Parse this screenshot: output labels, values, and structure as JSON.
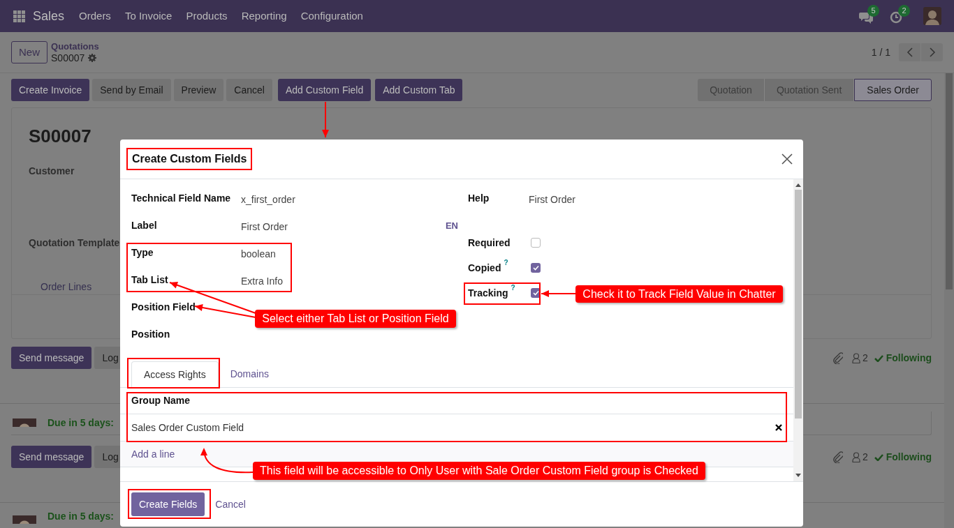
{
  "navbar": {
    "app": "Sales",
    "menu": [
      "Orders",
      "To Invoice",
      "Products",
      "Reporting",
      "Configuration"
    ],
    "messages_badge": "5",
    "activities_badge": "2"
  },
  "control_panel": {
    "new_button": "New",
    "breadcrumb": "Quotations",
    "record": "S00007",
    "pager": "1 / 1"
  },
  "action_buttons": [
    {
      "label": "Create Invoice",
      "kind": "primary"
    },
    {
      "label": "Send by Email",
      "kind": "secondary"
    },
    {
      "label": "Preview",
      "kind": "secondary"
    },
    {
      "label": "Cancel",
      "kind": "secondary"
    },
    {
      "label": "Add Custom Field",
      "kind": "primary"
    },
    {
      "label": "Add Custom Tab",
      "kind": "primary"
    }
  ],
  "status_stages": [
    {
      "label": "Quotation",
      "selected": false
    },
    {
      "label": "Quotation Sent",
      "selected": false
    },
    {
      "label": "Sales Order",
      "selected": true
    }
  ],
  "sheet": {
    "title": "S00007",
    "fields": [
      "Customer",
      "Quotation Template"
    ],
    "tab": "Order Lines"
  },
  "chatter": [
    {
      "buttons": [
        "Send message",
        "Log"
      ],
      "followers": "2",
      "follow": "Following",
      "activity": "Due in 5 days:"
    },
    {
      "buttons": [
        "Send message",
        "Log"
      ],
      "followers": "2",
      "follow": "Following",
      "activity": "Due in 5 days:"
    }
  ],
  "dialog": {
    "title": "Create Custom Fields",
    "fields": [
      {
        "label": "Technical Field Name",
        "value": "x_first_order"
      },
      {
        "label": "Label",
        "value": "First Order",
        "translate": "EN"
      },
      {
        "label": "Type",
        "value": "boolean"
      },
      {
        "label": "Tab List",
        "value": "Extra Info"
      },
      {
        "label": "Position Field"
      },
      {
        "label": "Position"
      }
    ],
    "help": {
      "label": "Help",
      "value": "First Order"
    },
    "options": [
      {
        "label": "Required",
        "checked": false
      },
      {
        "label": "Copied",
        "hint": "?",
        "checked": true
      },
      {
        "label": "Tracking",
        "hint": "?",
        "checked": true
      }
    ],
    "tabs": [
      {
        "label": "Access Rights",
        "selected": true
      },
      {
        "label": "Domains",
        "selected": false
      }
    ],
    "table": {
      "columns": [
        "Group Name"
      ],
      "rows": [
        "Sales Order Custom Field"
      ],
      "add_line": "Add a line"
    },
    "buttons": [
      {
        "label": "Create Fields",
        "kind": "primary"
      },
      {
        "label": "Cancel",
        "kind": "link"
      }
    ]
  },
  "annotations": [
    {
      "text": "Select either Tab List or Position Field"
    },
    {
      "text": "Check it to Track Field Value in Chatter"
    },
    {
      "text": "This field will be accessible to Only User with Sale Order Custom Field group is Checked"
    }
  ]
}
